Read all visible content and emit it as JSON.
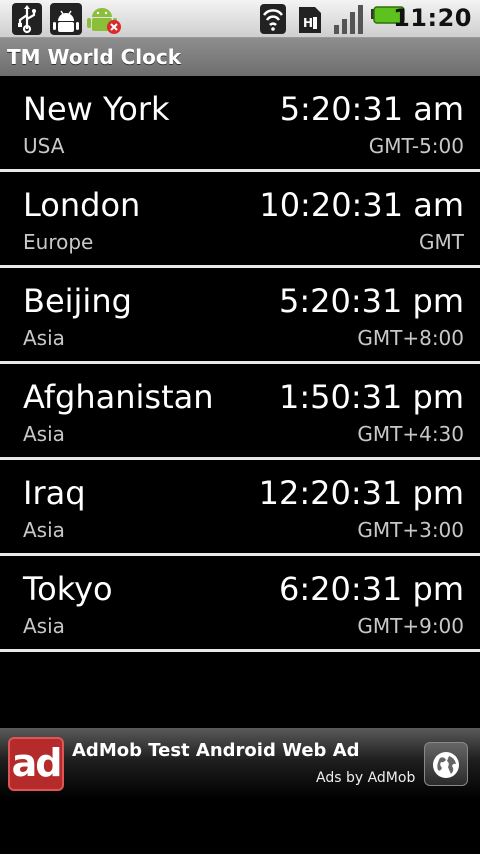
{
  "status_bar": {
    "time": "11:20",
    "icons": [
      "usb-icon",
      "debug-icon",
      "android-warning-icon",
      "wifi-icon",
      "sim-icon",
      "signal-icon",
      "battery-icon"
    ]
  },
  "app": {
    "title": "TM World Clock"
  },
  "clocks": [
    {
      "city": "New York",
      "region": "USA",
      "time": "5:20:31 am",
      "gmt": "GMT-5:00"
    },
    {
      "city": "London",
      "region": "Europe",
      "time": "10:20:31 am",
      "gmt": "GMT"
    },
    {
      "city": "Beijing",
      "region": "Asia",
      "time": "5:20:31 pm",
      "gmt": "GMT+8:00"
    },
    {
      "city": "Afghanistan",
      "region": "Asia",
      "time": "1:50:31 pm",
      "gmt": "GMT+4:30"
    },
    {
      "city": "Iraq",
      "region": "Asia",
      "time": "12:20:31 pm",
      "gmt": "GMT+3:00"
    },
    {
      "city": "Tokyo",
      "region": "Asia",
      "time": "6:20:31 pm",
      "gmt": "GMT+9:00"
    }
  ],
  "ad": {
    "logo_text": "ad",
    "title": "AdMob Test Android Web Ad",
    "by": "Ads by AdMob",
    "icon": "globe-icon"
  },
  "colors": {
    "background": "#000000",
    "titlebar": "#7e7e7e",
    "divider": "#e8e8e8",
    "secondary_text": "#c8c8c8",
    "ad_logo": "#b52a2a",
    "battery": "#5dc21e"
  }
}
